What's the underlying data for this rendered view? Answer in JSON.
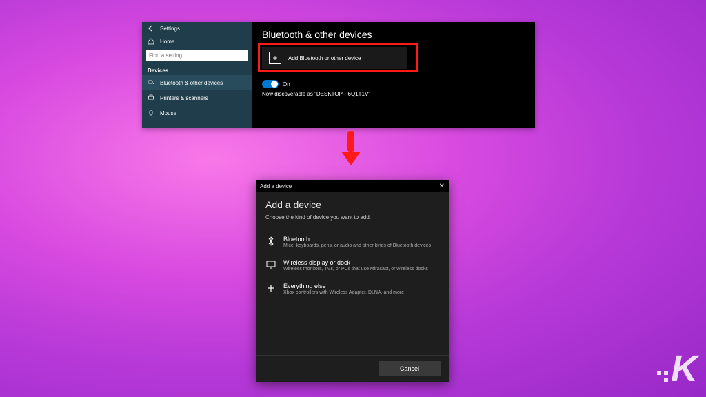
{
  "settings": {
    "back_aria": "Back",
    "title": "Settings",
    "home_label": "Home",
    "search_placeholder": "Find a setting",
    "section_label": "Devices",
    "nav": [
      {
        "label": "Bluetooth & other devices"
      },
      {
        "label": "Printers & scanners"
      },
      {
        "label": "Mouse"
      }
    ]
  },
  "main": {
    "page_title": "Bluetooth & other devices",
    "add_button_label": "Add Bluetooth or other device",
    "toggle_label": "On",
    "discoverable_text": "Now discoverable as \"DESKTOP-F6Q1T1V\""
  },
  "dialog": {
    "titlebar": "Add a device",
    "heading": "Add a device",
    "subheading": "Choose the kind of device you want to add.",
    "options": [
      {
        "title": "Bluetooth",
        "desc": "Mice, keyboards, pens, or audio and other kinds of Bluetooth devices"
      },
      {
        "title": "Wireless display or dock",
        "desc": "Wireless monitors, TVs, or PCs that use Miracast, or wireless docks"
      },
      {
        "title": "Everything else",
        "desc": "Xbox controllers with Wireless Adapter, DLNA, and more"
      }
    ],
    "cancel_label": "Cancel"
  },
  "logo": {
    "letter": "K"
  },
  "colors": {
    "highlight": "#ff1a1a",
    "toggle_on": "#0078d4"
  }
}
